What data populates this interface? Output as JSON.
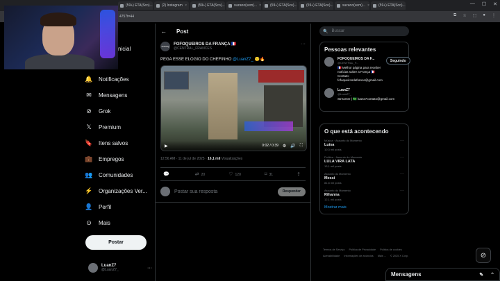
{
  "browser": {
    "tabs": [
      "(59+) ETA(Sco)...",
      "(2) Instagram",
      "(59+) ETA(Sco)...",
      "suzano(vem)...",
      "(59+) ETA(Sco)...",
      "(59+) ETA(Sco)...",
      "suzano(vem)...",
      "(59+) ETA(Sco)..."
    ],
    "url": "4757t=44",
    "window_min": "—",
    "window_max": "☐",
    "window_close": "✕"
  },
  "nav": {
    "partial_label": "nicial",
    "items": [
      {
        "icon": "bell-icon",
        "glyph": "🔔",
        "label": "Notificações"
      },
      {
        "icon": "mail-icon",
        "glyph": "✉",
        "label": "Mensagens"
      },
      {
        "icon": "grok-icon",
        "glyph": "⊘",
        "label": "Grok"
      },
      {
        "icon": "x-logo-icon",
        "glyph": "𝕏",
        "label": "Premium"
      },
      {
        "icon": "bookmark-icon",
        "glyph": "🔖",
        "label": "Itens salvos"
      },
      {
        "icon": "briefcase-icon",
        "glyph": "💼",
        "label": "Empregos"
      },
      {
        "icon": "people-icon",
        "glyph": "👥",
        "label": "Comunidades"
      },
      {
        "icon": "lightning-icon",
        "glyph": "⚡",
        "label": "Organizações Ver..."
      },
      {
        "icon": "profile-icon",
        "glyph": "👤",
        "label": "Perfil"
      },
      {
        "icon": "more-circle-icon",
        "glyph": "⊙",
        "label": "Mais"
      }
    ],
    "post_button": "Postar",
    "me": {
      "name": "LuanZ7",
      "handle": "@LuanZ7_"
    }
  },
  "main": {
    "back_glyph": "←",
    "title": "Post",
    "tweet": {
      "avatar_text": "FOFOQ",
      "author": "FOFOQUEIROS DA FRANÇA 🇫🇷",
      "handle": "@CENTRAL_FRANCES",
      "text_before": "PEGA ESSE ELOGIO DO CHEFINHO ",
      "mention": "@LuanZ7_",
      "text_after": " 😏🔥",
      "video_time": "0:02 / 0:39",
      "timestamp": "12:56 AM · 11 de jul de 2025 · ",
      "views": "16,1 mil",
      "views_label": " Visualizações",
      "reply_count": "",
      "retweet_count": "20",
      "like_count": "120",
      "bookmark_count": "31"
    },
    "reply": {
      "placeholder": "Postar sua resposta",
      "button": "Responder"
    }
  },
  "right": {
    "search_placeholder": "Buscar",
    "relevant": {
      "title": "Pessoas relevantes",
      "people": [
        {
          "name": "FOFOQUEIROS DA F...",
          "handle": "@CENTRAL_F...",
          "bio": "🇫🇷 Melhor página para receber notícias sobre a França 🇫🇷 Contato: fofoqueirosdafranca@gmail.com",
          "button": "Seguindo"
        },
        {
          "name": "LuanZ7",
          "handle": "@LuanZ7_",
          "bio": "Streamer | 🇧🇷 luanz7contato@gmail.com",
          "button": ""
        }
      ]
    },
    "trends": {
      "title": "O que está acontecendo",
      "items": [
        {
          "context": "Música · Assunto do Momento",
          "name": "Luísa",
          "count": "10,3 mil posts"
        },
        {
          "context": "Política · Assunto do Momento",
          "name": "LULA VIRA LATA",
          "count": "13,1 mil posts"
        },
        {
          "context": "Assunto do Momento",
          "name": "Messi",
          "count": "81,8 mil posts"
        },
        {
          "context": "Assunto do Momento",
          "name": "Rihanna",
          "count": "12,1 mil posts"
        }
      ],
      "show_more": "Mostrar mais"
    },
    "footer": [
      "Termos de Serviço",
      "Política de Privacidade",
      "Política de cookies",
      "Acessibilidade",
      "Informações de anúncios",
      "Mais ...",
      "© 2025 X Corp."
    ]
  },
  "drawer": {
    "title": "Mensagens"
  }
}
